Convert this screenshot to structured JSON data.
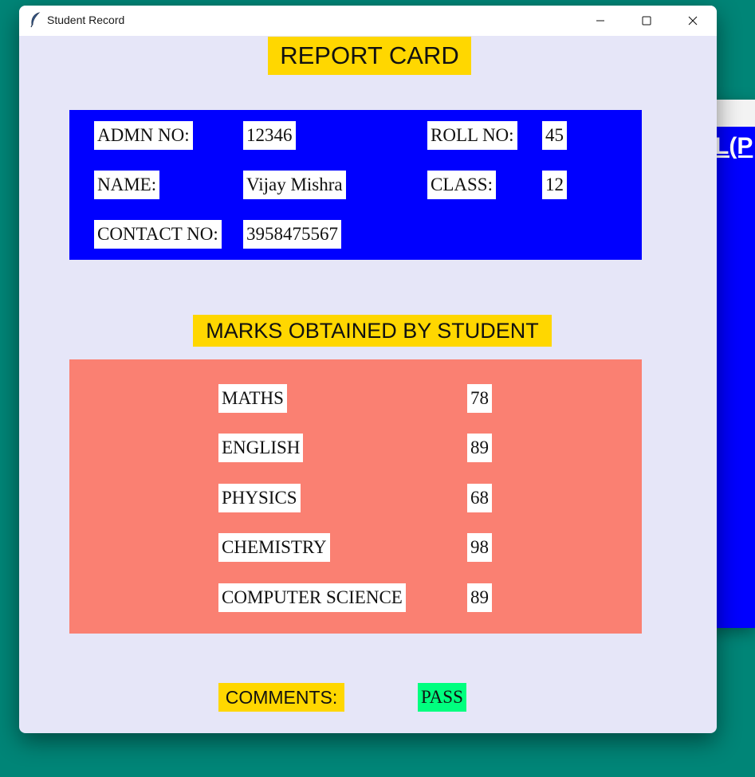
{
  "window": {
    "title": "Student Record",
    "controls": {
      "minimize_icon": "minimize-icon",
      "maximize_icon": "maximize-icon",
      "close_icon": "close-icon"
    }
  },
  "background_window": {
    "heading_fragment": "L(P"
  },
  "report": {
    "title": "REPORT CARD",
    "info": {
      "admn_label": "ADMN NO:",
      "admn_value": "12346",
      "roll_label": "ROLL NO:",
      "roll_value": "45",
      "name_label": "NAME:",
      "name_value": "Vijay Mishra",
      "class_label": "CLASS:",
      "class_value": "12",
      "contact_label": "CONTACT NO:",
      "contact_value": "3958475567"
    },
    "marks_title": "MARKS OBTAINED BY STUDENT",
    "marks": [
      {
        "subject": "MATHS",
        "score": "78"
      },
      {
        "subject": "ENGLISH",
        "score": "89"
      },
      {
        "subject": "PHYSICS",
        "score": "68"
      },
      {
        "subject": "CHEMISTRY",
        "score": "98"
      },
      {
        "subject": "COMPUTER SCIENCE",
        "score": "89"
      }
    ],
    "comments_label": "COMMENTS:",
    "comments_value": "PASS"
  },
  "colors": {
    "desktop": "#008577",
    "window_bg": "#e6e6f8",
    "highlight": "#ffd700",
    "info_panel": "#0000ff",
    "marks_panel": "#fa8072",
    "pass": "#00ff7f"
  }
}
